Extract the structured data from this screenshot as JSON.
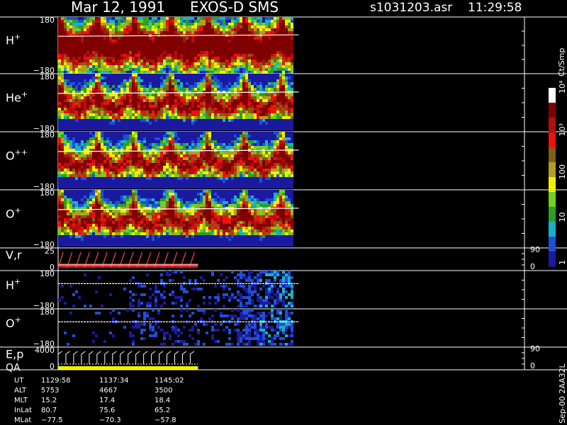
{
  "header": {
    "date": "Mar 12, 1991",
    "instrument": "EXOS-D SMS",
    "file": "s1031203.asr",
    "time": "11:29:58"
  },
  "side_label": "Sep-00 2AA32L",
  "colorbar": {
    "unit": "Ct/Smp",
    "tick_labels": [
      "1",
      "10",
      "100",
      "10³",
      "10⁴"
    ],
    "colors": [
      "#1a1aa0",
      "#1e4fd6",
      "#18b0c8",
      "#2aa02a",
      "#6ed21e",
      "#f0f000",
      "#b0a020",
      "#806010",
      "#f01010",
      "#b01010",
      "#800000",
      "#ffffff"
    ]
  },
  "chart_data": [
    {
      "type": "heatmap",
      "panel": "H+",
      "label": "H",
      "sup": "+",
      "ylabel_top": "180",
      "ylabel_bottom": "−180",
      "ylim": [
        -180,
        180
      ],
      "style": "spin-red",
      "coverage_fraction": 0.51,
      "stripes": 15
    },
    {
      "type": "heatmap",
      "panel": "He+",
      "label": "He",
      "sup": "+",
      "ylabel_top": "180",
      "ylabel_bottom": "−180",
      "ylim": [
        -180,
        180
      ],
      "style": "spin-red",
      "coverage_fraction": 0.51,
      "stripes": 15
    },
    {
      "type": "heatmap",
      "panel": "O++",
      "label": "O",
      "sup": "++",
      "ylabel_top": "180",
      "ylabel_bottom": "−180",
      "ylim": [
        -180,
        180
      ],
      "style": "spin-red",
      "coverage_fraction": 0.51,
      "stripes": 15
    },
    {
      "type": "heatmap",
      "panel": "O+",
      "label": "O",
      "sup": "+",
      "ylabel_top": "180",
      "ylabel_bottom": "−180",
      "ylim": [
        -180,
        180
      ],
      "style": "spin-red",
      "coverage_fraction": 0.51,
      "stripes": 15
    },
    {
      "type": "line",
      "panel": "V,r",
      "label": "V,r",
      "ylabel_top": "25",
      "ylabel_bottom": "0",
      "ylim": [
        0,
        25
      ],
      "right_top": "90",
      "right_bottom": "0",
      "teeth": 16
    },
    {
      "type": "heatmap",
      "panel": "H+ (2)",
      "label": "H",
      "sup": "+",
      "ylabel_top": "180",
      "ylabel_bottom": "−180",
      "ylim": [
        -180,
        180
      ],
      "style": "sparse",
      "coverage_fraction": 0.51
    },
    {
      "type": "heatmap",
      "panel": "O+ (2)",
      "label": "O",
      "sup": "+",
      "ylabel_top": "180",
      "ylabel_bottom": "−180",
      "ylim": [
        -180,
        180
      ],
      "style": "sparse",
      "coverage_fraction": 0.51
    },
    {
      "type": "line",
      "panel": "E,p QA",
      "label": "E,p",
      "label2": "QA",
      "ylabel_top": "4000",
      "ylabel_bottom": "0",
      "ylim": [
        0,
        4000
      ],
      "right_top": "90",
      "right_bottom": "0",
      "teeth": 18
    }
  ],
  "orbit_table": {
    "rows": [
      {
        "label": "UT",
        "values": [
          "1129:58",
          "1137:34",
          "1145:02"
        ]
      },
      {
        "label": "ALT",
        "values": [
          "5753",
          "4667",
          "3500"
        ]
      },
      {
        "label": "MLT",
        "values": [
          "15.2",
          "17.4",
          "18.4"
        ]
      },
      {
        "label": "InLat",
        "values": [
          "80.7",
          "75.6",
          "65.2"
        ]
      },
      {
        "label": "MLat",
        "values": [
          "−77.5",
          "−70.3",
          "−57.8"
        ]
      }
    ]
  }
}
